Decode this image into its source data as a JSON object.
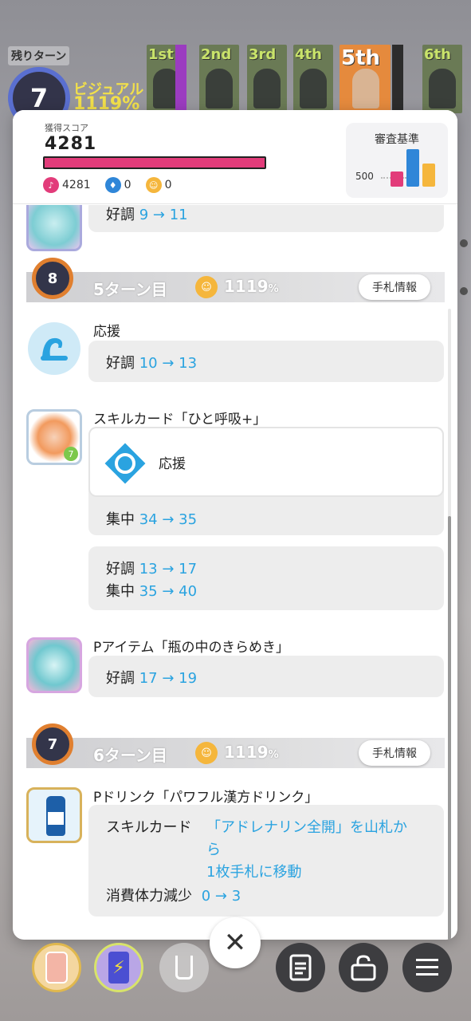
{
  "hud": {
    "turns_left_label": "残りターン",
    "turns_left_value": "7",
    "visual_label": "ビジュアル",
    "visual_score": "1119%",
    "ranks": [
      "1st",
      "2nd",
      "3rd",
      "4th",
      "5th",
      "6th"
    ]
  },
  "header": {
    "score_caption": "獲得スコア",
    "score_value": "4281",
    "attr_vocal": "4281",
    "attr_dance": "0",
    "attr_visual": "0",
    "criteria_title": "審査基準",
    "criteria_axis": "500"
  },
  "entries": {
    "top_partial": {
      "stat": "好調",
      "change": "9 → 11"
    },
    "turn5": {
      "badge": "8",
      "name": "5ターン目",
      "pct": "1119",
      "pct_unit": "%",
      "hand_btn": "手札情報",
      "cheer": {
        "title": "応援",
        "stat": "好調",
        "change": "10 → 13"
      },
      "skill": {
        "title": "スキルカード「ひと呼吸+」",
        "sub_title": "応援",
        "sub_stat": "集中",
        "sub_change": "34 → 35",
        "stat1": "好調",
        "change1": "13 → 17",
        "stat2": "集中",
        "change2": "35 → 40"
      },
      "item": {
        "title": "Pアイテム「瓶の中のきらめき」",
        "stat": "好調",
        "change": "17 → 19"
      }
    },
    "turn6": {
      "badge": "7",
      "name": "6ターン目",
      "pct": "1119",
      "pct_unit": "%",
      "hand_btn": "手札情報",
      "drink": {
        "title": "Pドリンク「パワフル漢方ドリンク」",
        "label1": "スキルカード",
        "text1a": "「アドレナリン全開」を山札か",
        "text1b": "ら",
        "text1c": "1枚手札に移動",
        "label2": "消費体力減少",
        "change2": "0 → 3"
      }
    }
  },
  "colors": {
    "vocal": "#e23c7a",
    "dance": "#2f86d8",
    "visual": "#f5b63c",
    "value_blue": "#2aa3e0"
  },
  "chart_data": {
    "type": "bar",
    "categories": [
      "vocal",
      "dance",
      "visual"
    ],
    "values": [
      200,
      500,
      310
    ],
    "ylim": [
      0,
      600
    ]
  }
}
